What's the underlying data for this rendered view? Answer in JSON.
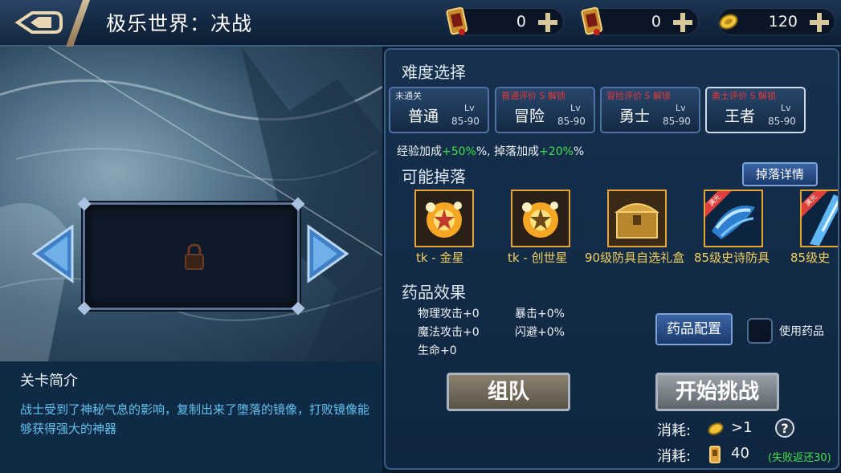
{
  "header": {
    "title": "极乐世界：决战",
    "resources": [
      {
        "icon": "red-ticket-icon",
        "value": "0"
      },
      {
        "icon": "red-ticket-icon",
        "value": "0"
      },
      {
        "icon": "gold-coin-icon",
        "value": "120"
      }
    ]
  },
  "intro": {
    "title": "关卡简介",
    "text": "战士受到了神秘气息的影响，复制出来了堕落的镜像，打败镜像能够获得强大的神器"
  },
  "difficulty": {
    "title": "难度选择",
    "levels": [
      {
        "tag": "未通关",
        "name": "普通",
        "lv": "Lv",
        "range": "85-90"
      },
      {
        "tag": "普通评价 S 解锁",
        "name": "冒险",
        "lv": "Lv",
        "range": "85-90"
      },
      {
        "tag": "冒险评价 S 解锁",
        "name": "勇士",
        "lv": "Lv",
        "range": "85-90"
      },
      {
        "tag": "勇士评价 S 解锁",
        "name": "王者",
        "lv": "Lv",
        "range": "85-90"
      }
    ],
    "bonus_prefix": "经验加成",
    "bonus_exp": "+50%",
    "bonus_mid": "%, 掉落加成",
    "bonus_drop": "+20%",
    "bonus_suffix": "%"
  },
  "drops": {
    "title": "可能掉落",
    "detail_button": "掉落详情",
    "items": [
      {
        "label": "tk - 金星",
        "icon": "gold-star-orb-icon"
      },
      {
        "label": "tk - 创世星",
        "icon": "gold-star-orb-icon"
      },
      {
        "label": "90级防具自选礼盒",
        "icon": "treasure-chest-icon"
      },
      {
        "label": "85级史诗防具",
        "icon": "epic-armor-icon",
        "ribbon": "满光"
      },
      {
        "label": "85级史",
        "icon": "epic-weapon-icon",
        "ribbon": "满光"
      }
    ]
  },
  "potion": {
    "title": "药品效果",
    "stats_left": [
      "物理攻击+0",
      "魔法攻击+0",
      "生命+0"
    ],
    "stats_right": [
      "暴击+0%",
      "闪避+0%"
    ],
    "config_button": "药品配置",
    "use_label": "使用药品"
  },
  "actions": {
    "team_button": "组队",
    "challenge_button": "开始挑战"
  },
  "costs": [
    {
      "label": "消耗:",
      "icon": "gold-coin-icon",
      "value": ">1"
    },
    {
      "label": "消耗:",
      "icon": "stamina-icon",
      "value": "40",
      "note": "(失败返还30)"
    }
  ]
}
